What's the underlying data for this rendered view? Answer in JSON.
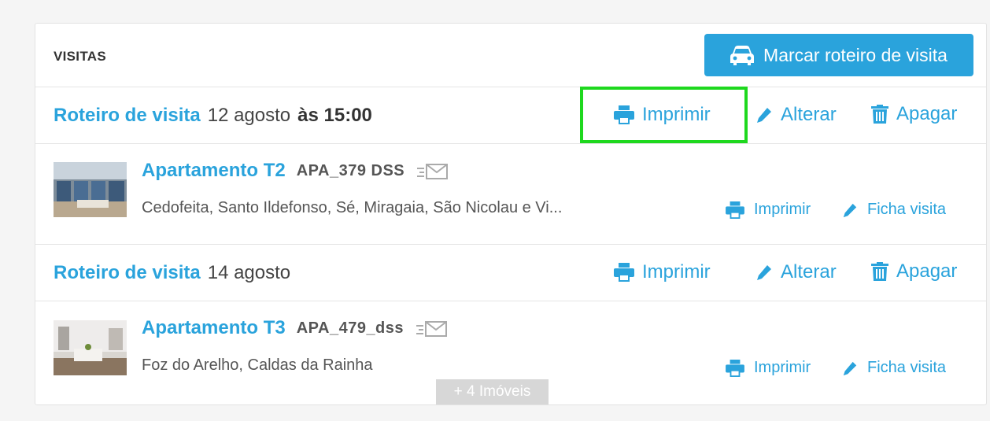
{
  "header": {
    "title": "VISITAS",
    "primary_button_label": "Marcar roteiro de visita"
  },
  "roteiros": [
    {
      "label": "Roteiro de visita",
      "date": "12 agosto",
      "time": "às 15:00",
      "actions": {
        "print": "Imprimir",
        "edit": "Alterar",
        "delete": "Apagar"
      },
      "imovel": {
        "name": "Apartamento T2",
        "ref": "APA_379 DSS",
        "location": "Cedofeita, Santo Ildefonso, Sé, Miragaia, São Nicolau e Vi...",
        "actions": {
          "print": "Imprimir",
          "ficha": "Ficha visita"
        }
      }
    },
    {
      "label": "Roteiro de visita",
      "date": "14 agosto",
      "time": "",
      "actions": {
        "print": "Imprimir",
        "edit": "Alterar",
        "delete": "Apagar"
      },
      "imovel": {
        "name": "Apartamento T3",
        "ref": "APA_479_dss",
        "location": "Foz do Arelho, Caldas da Rainha",
        "actions": {
          "print": "Imprimir",
          "ficha": "Ficha visita"
        }
      }
    }
  ],
  "more_imoveis": "+ 4 Imóveis",
  "colors": {
    "accent": "#2aa3dc",
    "highlight": "#1ed81e"
  },
  "icons": [
    "car-icon",
    "printer-icon",
    "pencil-icon",
    "trash-icon",
    "envelope-icon"
  ]
}
